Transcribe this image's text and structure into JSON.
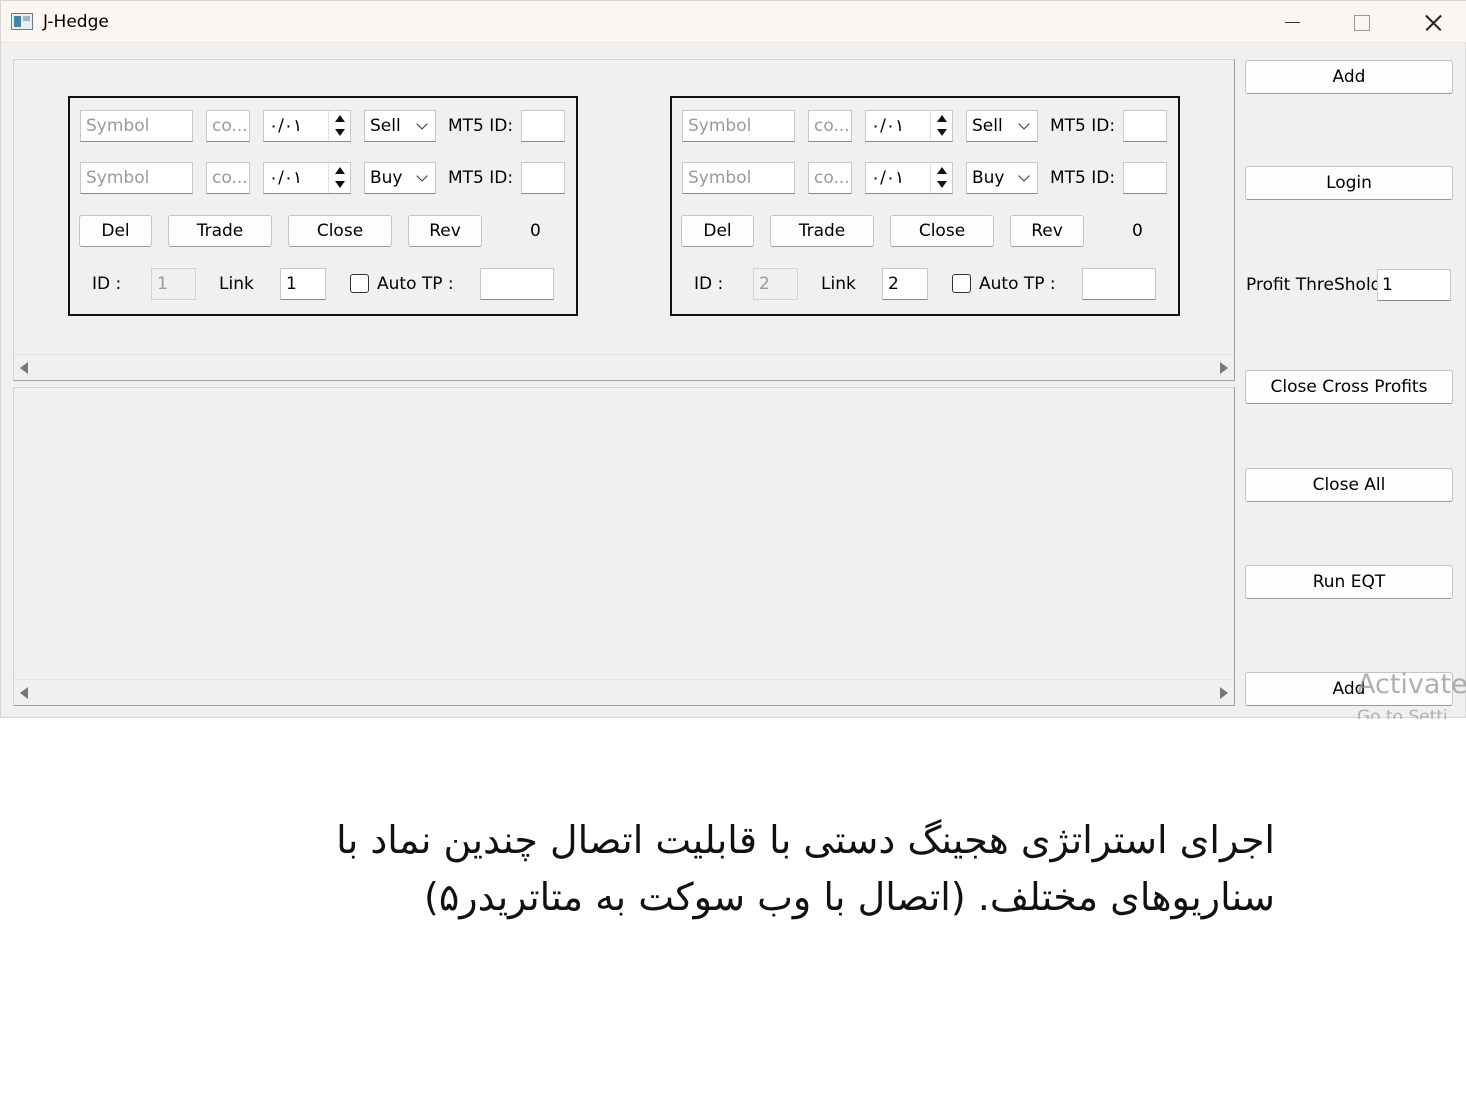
{
  "window": {
    "title": "J-Hedge",
    "controls": [
      "minimize",
      "maximize",
      "close"
    ]
  },
  "panels": [
    {
      "row1": {
        "symbol_placeholder": "Symbol",
        "comment_placeholder": "co...",
        "lot": "٠/٠١",
        "direction": "Sell",
        "mt5_label": "MT5 ID:",
        "mt5_value": ""
      },
      "row2": {
        "symbol_placeholder": "Symbol",
        "comment_placeholder": "co...",
        "lot": "٠/٠١",
        "direction": "Buy",
        "mt5_label": "MT5 ID:",
        "mt5_value": ""
      },
      "buttons": {
        "del": "Del",
        "trade": "Trade",
        "close": "Close",
        "rev": "Rev"
      },
      "profit": "0",
      "id_label": "ID :",
      "id_value": "1",
      "link_label": "Link",
      "link_value": "1",
      "auto_tp_label": "Auto TP :",
      "auto_tp_checked": false,
      "auto_tp_value": ""
    },
    {
      "row1": {
        "symbol_placeholder": "Symbol",
        "comment_placeholder": "co...",
        "lot": "٠/٠١",
        "direction": "Sell",
        "mt5_label": "MT5 ID:",
        "mt5_value": ""
      },
      "row2": {
        "symbol_placeholder": "Symbol",
        "comment_placeholder": "co...",
        "lot": "٠/٠١",
        "direction": "Buy",
        "mt5_label": "MT5 ID:",
        "mt5_value": ""
      },
      "buttons": {
        "del": "Del",
        "trade": "Trade",
        "close": "Close",
        "rev": "Rev"
      },
      "profit": "0",
      "id_label": "ID :",
      "id_value": "2",
      "link_label": "Link",
      "link_value": "2",
      "auto_tp_label": "Auto TP :",
      "auto_tp_checked": false,
      "auto_tp_value": ""
    }
  ],
  "sidebar": {
    "add_label": "Add",
    "login_label": "Login",
    "profit_threshold_label": "Profit ThreShold",
    "profit_threshold_value": "1",
    "close_cross_profits_label": "Close Cross Profits",
    "close_all_label": "Close All",
    "run_eqt_label": "Run EQT",
    "add_bottom_label": "Add"
  },
  "watermark": {
    "line1": "Activate",
    "line2": "Go to Setti"
  },
  "caption": {
    "line1": "اجرای استراتژی هجینگ دستی با قابلیت اتصال چندین نماد با",
    "line2": "سناریوهای مختلف. (اتصال با وب سوکت به متاتریدر۵)"
  }
}
